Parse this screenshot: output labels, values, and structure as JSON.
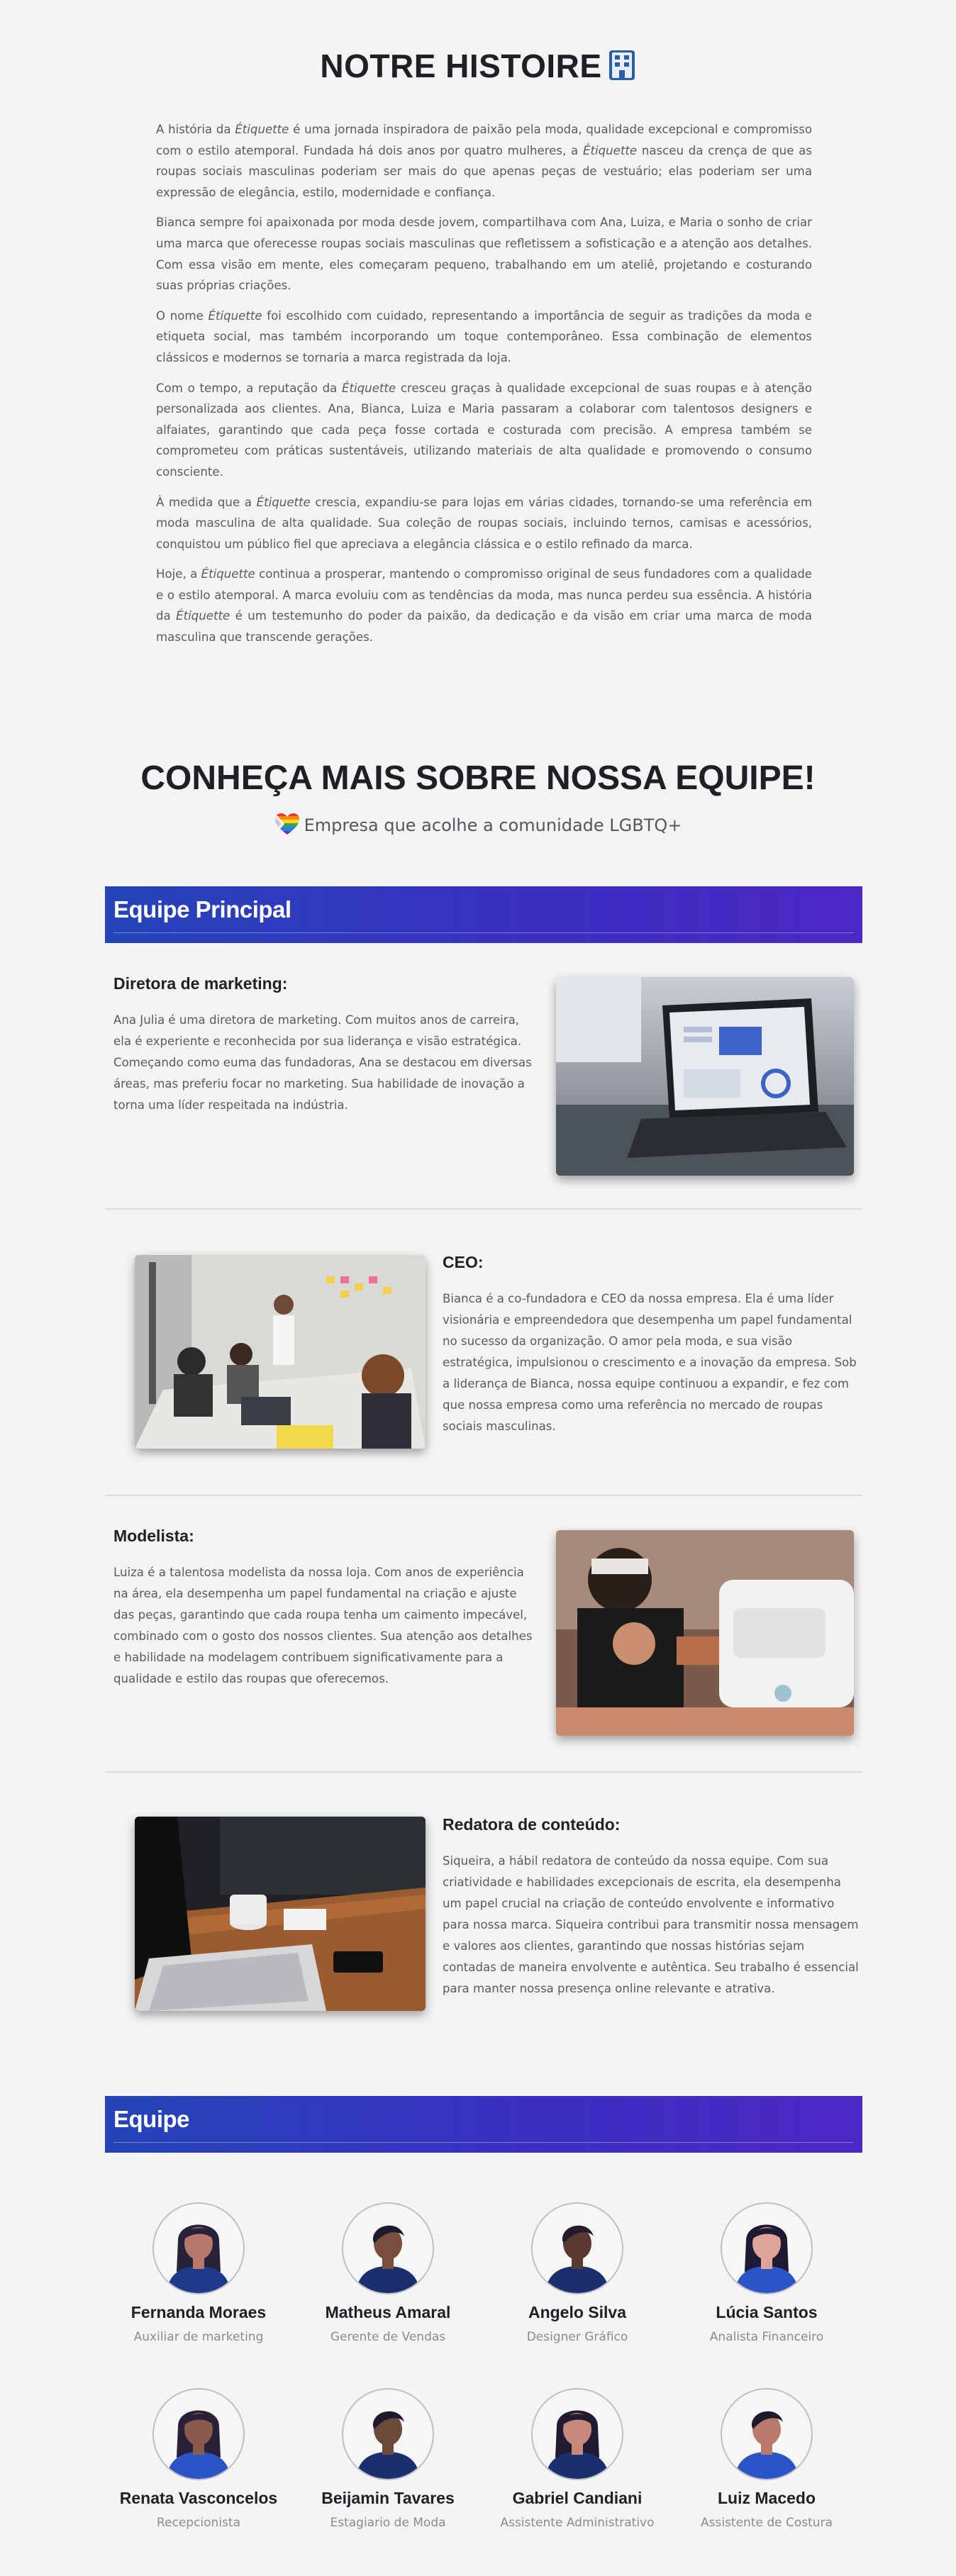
{
  "story": {
    "title": "NOTRE HISTOIRE",
    "title_icon": "building-icon",
    "paragraphs": [
      [
        "A história da ",
        "Étiquette",
        " é uma jornada inspiradora de paixão pela moda, qualidade excepcional e compromisso com o estilo atemporal. Fundada há dois anos por quatro mulheres, a ",
        "Étiquette",
        " nasceu da crença de que as roupas sociais masculinas poderiam ser mais do que apenas peças de vestuário; elas poderiam ser uma expressão de elegância, estilo, modernidade e confiança."
      ],
      [
        "Bianca sempre foi apaixonada por moda desde jovem, compartilhava com Ana, Luiza, e Maria o sonho de criar uma marca que oferecesse roupas sociais masculinas que refletissem a sofisticação e a atenção aos detalhes. Com essa visão em mente, eles começaram pequeno, trabalhando em um ateliê, projetando e costurando suas próprias criações."
      ],
      [
        "O nome ",
        "Étiquette",
        " foi escolhido com cuidado, representando a importância de seguir as tradições da moda e etiqueta social, mas também incorporando um toque contemporâneo. Essa combinação de elementos clássicos e modernos se tornaria a marca registrada da loja."
      ],
      [
        "Com o tempo, a reputação da ",
        "Étiquette",
        " cresceu graças à qualidade excepcional de suas roupas e à atenção personalizada aos clientes. Ana, Bianca, Luiza e Maria passaram a colaborar com talentosos designers e alfaiates, garantindo que cada peça fosse cortada e costurada com precisão. A empresa também se comprometeu com práticas sustentáveis, utilizando materiais de alta qualidade e promovendo o consumo consciente."
      ],
      [
        "À medida que a ",
        "Étiquette",
        " crescia, expandiu-se para lojas em várias cidades, tornando-se uma referência em moda masculina de alta qualidade. Sua coleção de roupas sociais, incluindo ternos, camisas e acessórios, conquistou um público fiel que apreciava a elegância clássica e o estilo refinado da marca."
      ],
      [
        "Hoje, a ",
        "Étiquette",
        " continua a prosperar, mantendo o compromisso original de seus fundadores com a qualidade e o estilo atemporal. A marca evoluiu com as tendências da moda, mas nunca perdeu sua essência. A história da ",
        "Étiquette",
        " é um testemunho do poder da paixão, da dedicação e da visão em criar uma marca de moda masculina que transcende gerações."
      ]
    ]
  },
  "team": {
    "title": "CONHEÇA MAIS SOBRE NOSSA EQUIPE!",
    "lgbt_text": "Empresa que acolhe a comunidade LGBTQ+",
    "lgbt_icon": "rainbow-heart-icon",
    "main_banner": "Equipe Principal",
    "members": [
      {
        "role": "Diretora de marketing:",
        "text": "Ana Julia é uma diretora de marketing. Com muitos anos de carreira, ela é experiente e reconhecida por sua liderança e visão estratégica. Começando como euma das fundadoras, Ana se destacou em diversas áreas, mas preferiu focar no marketing. Sua habilidade de inovação a torna uma líder respeitada na indústria.",
        "photo": "laptop-dashboard-photo"
      },
      {
        "role": "CEO:",
        "text": "Bianca é a co-fundadora e CEO da nossa empresa. Ela é uma líder visionária e empreendedora que desempenha um papel fundamental no sucesso da organização. O amor pela moda, e sua visão estratégica, impulsionou o crescimento e a inovação da empresa. Sob a liderança de Bianca, nossa equipe continuou a expandir, e fez com que nossa empresa como uma referência no mercado de roupas sociais masculinas.",
        "photo": "team-meeting-photo"
      },
      {
        "role": "Modelista:",
        "text": "Luiza é a talentosa modelista da nossa loja. Com anos de experiência na área, ela desempenha um papel fundamental na criação e ajuste das peças, garantindo que cada roupa tenha um caimento impecável, combinado com o gosto dos nossos clientes. Sua atenção aos detalhes e habilidade na modelagem contribuem significativamente para a qualidade e estilo das roupas que oferecemos.",
        "photo": "sewing-machine-photo"
      },
      {
        "role": "Redatora de conteúdo:",
        "text": "Siqueira, a hábil redatora de conteúdo da nossa equipe. Com sua criatividade e habilidades excepcionais de escrita, ela desempenha um papel crucial na criação de conteúdo envolvente e informativo para nossa marca. Siqueira contribui para transmitir nossa mensagem e valores aos clientes, garantindo que nossas histórias sejam contadas de maneira envolvente e autêntica. Seu trabalho é essencial para manter nossa presença online relevante e atrativa.",
        "photo": "desk-laptop-coffee-photo"
      }
    ],
    "team_banner": "Equipe",
    "people": [
      {
        "name": "Fernanda Moraes",
        "role": "Auxiliar de marketing"
      },
      {
        "name": "Matheus Amaral",
        "role": "Gerente de Vendas"
      },
      {
        "name": "Angelo Silva",
        "role": "Designer Gráfico"
      },
      {
        "name": "Lúcia Santos",
        "role": "Analista Financeiro"
      },
      {
        "name": "Renata Vasconcelos",
        "role": "Recepcionista"
      },
      {
        "name": "Beijamin Tavares",
        "role": "Estagiario de Moda"
      },
      {
        "name": "Gabriel Candiani",
        "role": "Assistente Administrativo"
      },
      {
        "name": "Luiz Macedo",
        "role": "Assistente de Costura"
      }
    ]
  },
  "colors": {
    "banner_start": "#2445b8",
    "banner_end": "#4c27c3",
    "title_text": "#1e2026",
    "body_text": "#5a5a62"
  }
}
